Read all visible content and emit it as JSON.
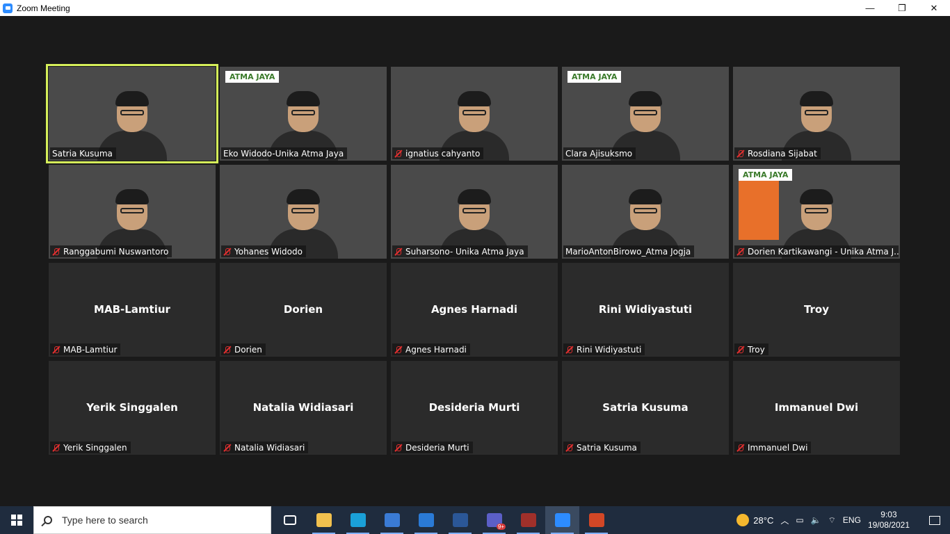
{
  "window": {
    "title": "Zoom Meeting",
    "minimize": "—",
    "restore": "❐",
    "close": "✕"
  },
  "video_tiles": [
    {
      "name": "Satria Kusuma",
      "muted": false,
      "active": true,
      "bg": "bg-orange"
    },
    {
      "name": "Eko Widodo-Unika Atma Jaya",
      "muted": false,
      "bg": "bg-pinkarch",
      "logo": "ATMA JAYA"
    },
    {
      "name": "ignatius cahyanto",
      "muted": true,
      "bg": "bg-campus"
    },
    {
      "name": "Clara Ajisuksmo",
      "muted": false,
      "bg": "bg-gold",
      "logo": "ATMA JAYA"
    },
    {
      "name": "Rosdiana Sijabat",
      "muted": true,
      "bg": "bg-beach"
    },
    {
      "name": "Ranggabumi Nuswantoro",
      "muted": true,
      "bg": "bg-pattern"
    },
    {
      "name": "Yohanes Widodo",
      "muted": true,
      "bg": "bg-white76"
    },
    {
      "name": "Suharsono- Unika Atma Jaya",
      "muted": true,
      "bg": "bg-field"
    },
    {
      "name": "MarioAntonBirowo_Atma Jogja",
      "muted": false,
      "bg": "bg-blue"
    },
    {
      "name": "Dorien Kartikawangi - Unika Atma J...",
      "muted": true,
      "bg": "bg-orange2",
      "logo": "ATMA JAYA"
    }
  ],
  "name_tiles": [
    {
      "display": "MAB-Lamtiur",
      "label": "MAB-Lamtiur"
    },
    {
      "display": "Dorien",
      "label": "Dorien"
    },
    {
      "display": "Agnes Harnadi",
      "label": "Agnes Harnadi"
    },
    {
      "display": "Rini Widiyastuti",
      "label": "Rini Widiyastuti"
    },
    {
      "display": "Troy",
      "label": "Troy"
    },
    {
      "display": "Yerik Singgalen",
      "label": "Yerik Singgalen"
    },
    {
      "display": "Natalia Widiasari",
      "label": "Natalia Widiasari"
    },
    {
      "display": "Desideria Murti",
      "label": "Desideria Murti"
    },
    {
      "display": "Satria Kusuma",
      "label": "Satria Kusuma"
    },
    {
      "display": "Immanuel Dwi",
      "label": "Immanuel Dwi"
    }
  ],
  "taskbar": {
    "search_placeholder": "Type here to search",
    "apps": [
      {
        "name": "task-view-icon",
        "color": "#1f2c3e"
      },
      {
        "name": "file-explorer-icon",
        "color": "#f2c14e"
      },
      {
        "name": "edge-icon",
        "color": "#1aa0d8"
      },
      {
        "name": "store-icon",
        "color": "#3a7bd5"
      },
      {
        "name": "mail-icon",
        "color": "#2a7ad6"
      },
      {
        "name": "word-icon",
        "color": "#2b5797"
      },
      {
        "name": "teams-icon",
        "color": "#5b5fc7",
        "badge": "9+"
      },
      {
        "name": "winrar-icon",
        "color": "#a0302a"
      },
      {
        "name": "zoom-icon",
        "color": "#2d8cff"
      },
      {
        "name": "powerpoint-icon",
        "color": "#d24726"
      }
    ],
    "weather_temp": "28°C",
    "language": "ENG",
    "time": "9:03",
    "date": "19/08/2021"
  }
}
